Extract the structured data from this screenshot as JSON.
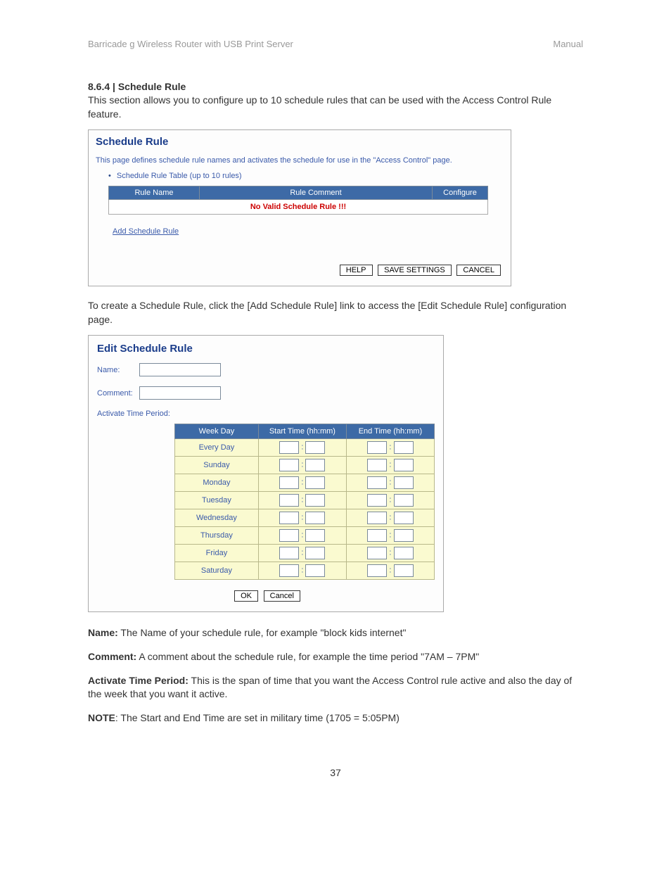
{
  "header": {
    "left": "Barricade g Wireless Router with USB Print Server",
    "right": "Manual"
  },
  "section": {
    "number_title": "8.6.4 | Schedule Rule",
    "intro": "This section allows you to configure up to 10 schedule rules that can be used with the Access Control Rule feature."
  },
  "panel1": {
    "title": "Schedule Rule",
    "desc": "This page defines schedule rule names and activates the schedule for use in the \"Access Control\" page.",
    "bullet": "Schedule Rule Table (up to 10 rules)",
    "cols": {
      "name": "Rule Name",
      "comment": "Rule Comment",
      "configure": "Configure"
    },
    "novalid": "No Valid Schedule Rule !!!",
    "add_link": "Add Schedule Rule",
    "buttons": {
      "help": "HELP",
      "save": "SAVE SETTINGS",
      "cancel": "CANCEL"
    }
  },
  "mid_text": "To create a Schedule Rule, click the [Add Schedule Rule] link to access the [Edit Schedule Rule] configuration page.",
  "panel2": {
    "title": "Edit Schedule Rule",
    "name_label": "Name:",
    "comment_label": "Comment:",
    "atp_label": "Activate Time Period:",
    "cols": {
      "weekday": "Week Day",
      "start": "Start Time (hh:mm)",
      "end": "End Time (hh:mm)"
    },
    "days": [
      "Every Day",
      "Sunday",
      "Monday",
      "Tuesday",
      "Wednesday",
      "Thursday",
      "Friday",
      "Saturday"
    ],
    "buttons": {
      "ok": "OK",
      "cancel": "Cancel"
    }
  },
  "definitions": {
    "name": {
      "label": "Name:",
      "text": " The Name of your schedule rule, for example \"block kids internet\""
    },
    "comment": {
      "label": "Comment:",
      "text": " A comment about the schedule rule, for example the time period \"7AM – 7PM\""
    },
    "atp": {
      "label": "Activate Time Period:",
      "text": " This is the span of time that you want the Access Control rule active and also the day of the week that you want it active."
    },
    "note": {
      "label": "NOTE",
      "text": ": The Start and End Time are set in military time (1705 = 5:05PM)"
    }
  },
  "page_number": "37"
}
